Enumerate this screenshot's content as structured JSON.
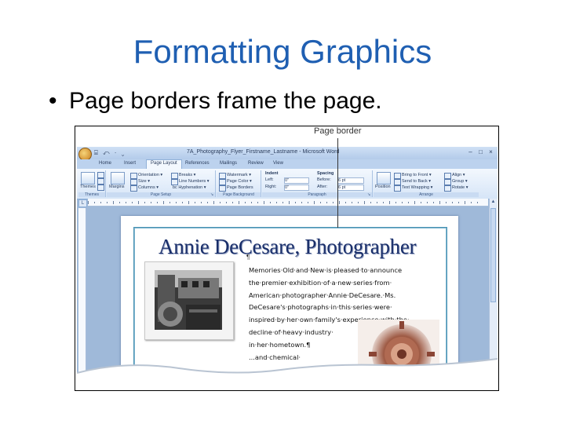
{
  "slide": {
    "title": "Formatting Graphics",
    "bullet_symbol": "•",
    "bullet_text": "Page borders frame the page."
  },
  "callout": {
    "label": "Page border"
  },
  "word_window": {
    "title": "7A_Photography_Flyer_Firstname_Lastname - Microsoft Word",
    "quick_access": "⌸ ↶ · ⌄",
    "controls": [
      "–",
      "□",
      "×"
    ],
    "tabs": [
      "Home",
      "Insert",
      "Page Layout",
      "References",
      "Mailings",
      "Review",
      "View"
    ],
    "active_tab": "Page Layout",
    "ribbon": {
      "themes": {
        "label": "Themes",
        "button": "Themes"
      },
      "page_setup": {
        "label": "Page Setup",
        "margins": "Margins",
        "items": [
          "Orientation ▾",
          "Size ▾",
          "Columns ▾",
          "Breaks ▾",
          "Line Numbers ▾",
          "bc Hyphenation ▾"
        ]
      },
      "page_background": {
        "label": "Page Background",
        "items": [
          "Watermark ▾",
          "Page Color ▾",
          "Page Borders"
        ]
      },
      "paragraph": {
        "label": "Paragraph",
        "indent_title": "Indent",
        "spacing_title": "Spacing",
        "indent_left_label": "Left:",
        "indent_left_value": "0\"",
        "indent_right_label": "Right:",
        "indent_right_value": "0\"",
        "spacing_before_label": "Before:",
        "spacing_before_value": "6 pt",
        "spacing_after_label": "After:",
        "spacing_after_value": "6 pt"
      },
      "arrange": {
        "label": "Arrange",
        "position": "Position",
        "items": [
          "Bring to Front ▾",
          "Send to Back ▾",
          "Text Wrapping ▾",
          "Align ▾",
          "Group ▾",
          "Rotate ▾"
        ]
      }
    }
  },
  "document": {
    "heading": "Annie DeCesare, Photographer",
    "para_mark": "¶",
    "body_lines": [
      "Memories·Old·and·New·is·pleased·to·announce",
      "the·premier·exhibition·of·a·new·series·from·",
      "American·photographer·Annie·DeCesare.·Ms.",
      "DeCesare's·photographs·in·this·series·were·",
      "inspired·by·her·own·family's·experience·with·the·",
      "decline·of·heavy·industry·",
      "in·her·hometown.¶",
      "...and·chemical·"
    ]
  },
  "colors": {
    "title_blue": "#1f5fb2",
    "heading_navy": "#1a2f6a",
    "page_border_teal": "#4b93b4",
    "word_chrome_blue": "#9fb9d9"
  }
}
